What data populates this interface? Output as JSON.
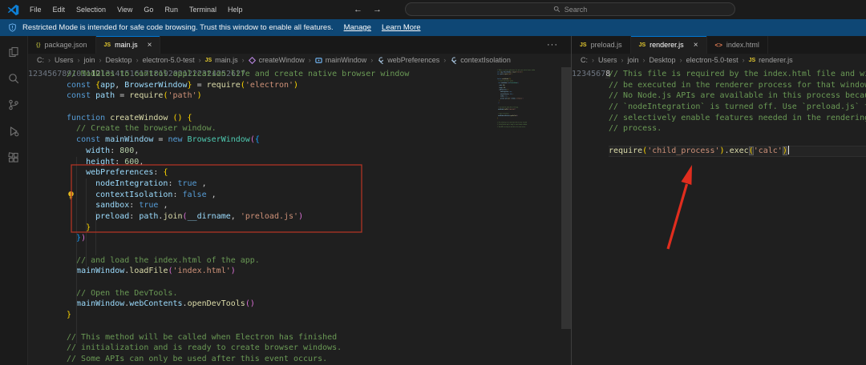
{
  "titlebar": {
    "menus": [
      "File",
      "Edit",
      "Selection",
      "View",
      "Go",
      "Run",
      "Terminal",
      "Help"
    ],
    "search_placeholder": "Search",
    "back_glyph": "←",
    "forward_glyph": "→"
  },
  "banner": {
    "text": "Restricted Mode is intended for safe code browsing. Trust this window to enable all features.",
    "links": [
      "Manage",
      "Learn More"
    ]
  },
  "activity_bar": [
    "explorer",
    "search",
    "source-control",
    "run-and-debug",
    "extensions"
  ],
  "icons": {
    "js": "JS",
    "json": "{}",
    "html": "<>",
    "close": "×",
    "more": "···",
    "crumb_sep": "›"
  },
  "colors": {
    "accent": "#0078d4",
    "banner_bg": "#0e4775",
    "annotation_box": "#b03425",
    "annotation_arrow": "#e02d1e"
  },
  "left_editor": {
    "tabs": [
      {
        "icon": "json",
        "label": "package.json",
        "active": false,
        "close": false
      },
      {
        "icon": "js",
        "label": "main.js",
        "active": true,
        "close": true
      }
    ],
    "breadcrumb": [
      {
        "label": "C:"
      },
      {
        "label": "Users"
      },
      {
        "label": "join"
      },
      {
        "label": "Desktop"
      },
      {
        "label": "electron-5.0-test"
      },
      {
        "icon": "js",
        "label": "main.js"
      },
      {
        "icon": "method",
        "label": "createWindow"
      },
      {
        "icon": "variable",
        "label": "mainWindow"
      },
      {
        "icon": "property",
        "label": "webPreferences"
      },
      {
        "icon": "property",
        "label": "contextIsolation"
      }
    ],
    "active_line": 12,
    "lines": [
      [
        [
          "cmt",
          "// Modules to control application life and create native browser window"
        ]
      ],
      [
        [
          "kw",
          "const "
        ],
        [
          "b1",
          "{"
        ],
        [
          "var",
          "app"
        ],
        [
          "pun",
          ", "
        ],
        [
          "var",
          "BrowserWindow"
        ],
        [
          "b1",
          "}"
        ],
        [
          "pun",
          " = "
        ],
        [
          "fn",
          "require"
        ],
        [
          "b1",
          "("
        ],
        [
          "str",
          "'electron'"
        ],
        [
          "b1",
          ")"
        ]
      ],
      [
        [
          "kw",
          "const "
        ],
        [
          "var",
          "path"
        ],
        [
          "pun",
          " = "
        ],
        [
          "fn",
          "require"
        ],
        [
          "b1",
          "("
        ],
        [
          "str",
          "'path'"
        ],
        [
          "b1",
          ")"
        ]
      ],
      [],
      [
        [
          "kw",
          "function "
        ],
        [
          "fn",
          "createWindow "
        ],
        [
          "b1",
          "()"
        ],
        [
          "txt",
          " "
        ],
        [
          "b1",
          "{"
        ]
      ],
      [
        [
          "txt",
          "  "
        ],
        [
          "cmt",
          "// Create the browser window."
        ]
      ],
      [
        [
          "txt",
          "  "
        ],
        [
          "kw",
          "const "
        ],
        [
          "var",
          "mainWindow"
        ],
        [
          "pun",
          " = "
        ],
        [
          "kw",
          "new "
        ],
        [
          "cls",
          "BrowserWindow"
        ],
        [
          "b2",
          "("
        ],
        [
          "b3",
          "{"
        ]
      ],
      [
        [
          "txt",
          "    "
        ],
        [
          "var",
          "width"
        ],
        [
          "pun",
          ": "
        ],
        [
          "num",
          "800"
        ],
        [
          "pun",
          ","
        ]
      ],
      [
        [
          "txt",
          "    "
        ],
        [
          "var",
          "height"
        ],
        [
          "pun",
          ": "
        ],
        [
          "num",
          "600"
        ],
        [
          "pun",
          ","
        ]
      ],
      [
        [
          "txt",
          "    "
        ],
        [
          "var",
          "webPreferences"
        ],
        [
          "pun",
          ": "
        ],
        [
          "b1",
          "{"
        ]
      ],
      [
        [
          "txt",
          "      "
        ],
        [
          "var",
          "nodeIntegration"
        ],
        [
          "pun",
          ": "
        ],
        [
          "kw",
          "true"
        ],
        [
          "pun",
          " ,"
        ]
      ],
      [
        [
          "txt",
          "      "
        ],
        [
          "var",
          "contextIsolation"
        ],
        [
          "pun",
          ": "
        ],
        [
          "kw",
          "false"
        ],
        [
          "pun",
          " ,"
        ]
      ],
      [
        [
          "txt",
          "      "
        ],
        [
          "var",
          "sandbox"
        ],
        [
          "pun",
          ": "
        ],
        [
          "kw",
          "true"
        ],
        [
          "pun",
          " ,"
        ]
      ],
      [
        [
          "txt",
          "      "
        ],
        [
          "var",
          "preload"
        ],
        [
          "pun",
          ": "
        ],
        [
          "var",
          "path"
        ],
        [
          "pun",
          "."
        ],
        [
          "fn",
          "join"
        ],
        [
          "b2",
          "("
        ],
        [
          "var",
          "__dirname"
        ],
        [
          "pun",
          ", "
        ],
        [
          "str",
          "'preload.js'"
        ],
        [
          "b2",
          ")"
        ]
      ],
      [
        [
          "txt",
          "    "
        ],
        [
          "b1",
          "}"
        ]
      ],
      [
        [
          "txt",
          "  "
        ],
        [
          "b3",
          "}"
        ],
        [
          "b2",
          ")"
        ]
      ],
      [],
      [
        [
          "txt",
          "  "
        ],
        [
          "cmt",
          "// and load the index.html of the app."
        ]
      ],
      [
        [
          "txt",
          "  "
        ],
        [
          "var",
          "mainWindow"
        ],
        [
          "pun",
          "."
        ],
        [
          "fn",
          "loadFile"
        ],
        [
          "b2",
          "("
        ],
        [
          "str",
          "'index.html'"
        ],
        [
          "b2",
          ")"
        ]
      ],
      [],
      [
        [
          "txt",
          "  "
        ],
        [
          "cmt",
          "// Open the DevTools."
        ]
      ],
      [
        [
          "txt",
          "  "
        ],
        [
          "var",
          "mainWindow"
        ],
        [
          "pun",
          "."
        ],
        [
          "var",
          "webContents"
        ],
        [
          "pun",
          "."
        ],
        [
          "fn",
          "openDevTools"
        ],
        [
          "b2",
          "()"
        ]
      ],
      [
        [
          "b1",
          "}"
        ]
      ],
      [],
      [
        [
          "cmt",
          "// This method will be called when Electron has finished"
        ]
      ],
      [
        [
          "cmt",
          "// initialization and is ready to create browser windows."
        ]
      ],
      [
        [
          "cmt",
          "// Some APIs can only be used after this event occurs."
        ]
      ]
    ]
  },
  "right_editor": {
    "tabs": [
      {
        "icon": "js",
        "label": "preload.js",
        "active": false,
        "close": false
      },
      {
        "icon": "js",
        "label": "renderer.js",
        "active": true,
        "close": true
      },
      {
        "icon": "html",
        "label": "index.html",
        "active": false,
        "close": false
      }
    ],
    "breadcrumb": [
      {
        "label": "C:"
      },
      {
        "label": "Users"
      },
      {
        "label": "join"
      },
      {
        "label": "Desktop"
      },
      {
        "label": "electron-5.0-test"
      },
      {
        "icon": "js",
        "label": "renderer.js"
      }
    ],
    "active_line": 8,
    "cursor_line": 8,
    "lines": [
      [
        [
          "cmt",
          "// This file is required by the index.html file and will"
        ]
      ],
      [
        [
          "cmt",
          "// be executed in the renderer process for that window."
        ]
      ],
      [
        [
          "cmt",
          "// No Node.js APIs are available in this process because"
        ]
      ],
      [
        [
          "cmt",
          "// `nodeIntegration` is turned off. Use `preload.js` to"
        ]
      ],
      [
        [
          "cmt",
          "// selectively enable features needed in the rendering"
        ]
      ],
      [
        [
          "cmt",
          "// process."
        ]
      ],
      [],
      [
        [
          "fn",
          "require"
        ],
        [
          "b1",
          "("
        ],
        [
          "str",
          "'child_process'"
        ],
        [
          "b1",
          ")"
        ],
        [
          "pun",
          "."
        ],
        [
          "fn",
          "exec"
        ],
        [
          "bm",
          "("
        ],
        [
          "str",
          "'calc'"
        ],
        [
          "bm",
          ")"
        ]
      ]
    ]
  }
}
